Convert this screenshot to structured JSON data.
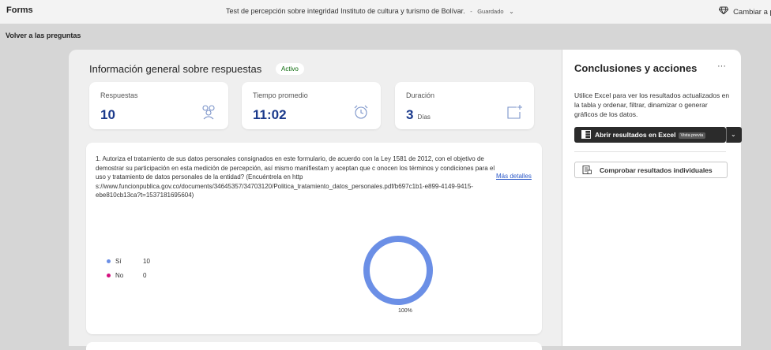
{
  "header": {
    "app_name": "Forms",
    "form_title": "Test de percepción sobre integridad Instituto de cultura y turismo de Bolívar.",
    "separator": "-",
    "save_status": "Guardado",
    "switch_label": "Cambiar a p"
  },
  "nav": {
    "back_label": "Volver a las preguntas"
  },
  "summary": {
    "title": "Información general sobre respuestas",
    "status_badge": "Activo",
    "stats": [
      {
        "label": "Respuestas",
        "value": "10",
        "unit": "",
        "icon": "people-icon"
      },
      {
        "label": "Tiempo promedio",
        "value": "11:02",
        "unit": "",
        "icon": "alarm-clock-icon"
      },
      {
        "label": "Duración",
        "value": "3",
        "unit": "Días",
        "icon": "calendar-add-icon"
      }
    ]
  },
  "question": {
    "text": "1.  Autoriza el tratamiento de sus datos personales consignados en este formulario, de acuerdo con la Ley 1581 de 2012, con el objetivo de demostrar su participación en esta medición de percepción, así mismo manifiestam y aceptan que c onocen los términos y condiciones para el uso y tratamiento de datos personales de la entidad? (Encuéntrela en http s://www.funcionpublica.gov.co/documents/34645357/34703120/Politica_tratamiento_datos_personales.pdf/b697c1b1-e899-4149-9415-ebe810cb13ca?t=1537181695604)",
    "more_label": "Más detalles",
    "donut_percent_label": "100%"
  },
  "chart_data": {
    "type": "pie",
    "categories": [
      "Sí",
      "No"
    ],
    "values": [
      10,
      0
    ],
    "colors": [
      "#6b8fe6",
      "#d4107f"
    ]
  },
  "panel": {
    "title": "Conclusiones y acciones",
    "more_label": "···",
    "description": "Utilice Excel para ver los resultados actualizados en la tabla y ordenar, filtrar, dinamizar o generar gráficos de los datos.",
    "excel_button": "Abrir resultados en Excel",
    "excel_preview_badge": "Vista previa",
    "check_button": "Comprobar resultados individuales"
  }
}
